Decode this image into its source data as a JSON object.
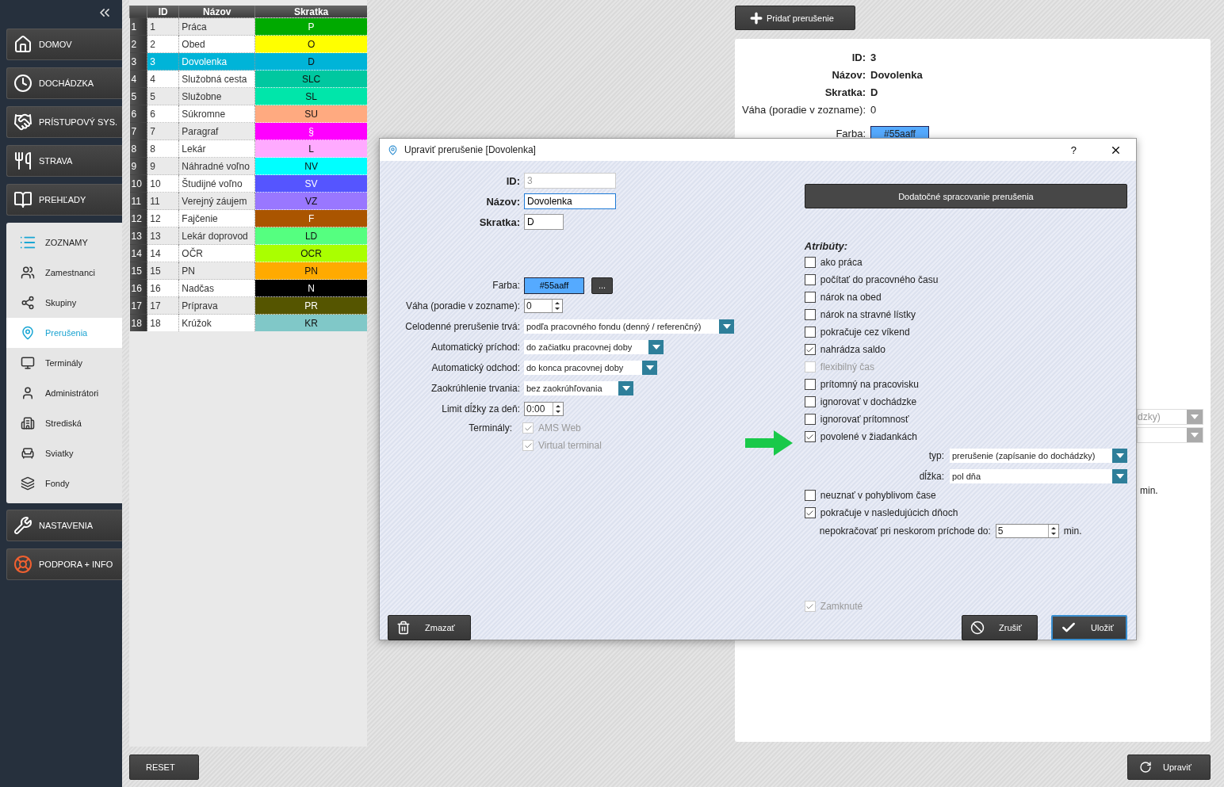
{
  "sidebar": {
    "main_items": [
      {
        "label": "DOMOV",
        "kind": "home"
      },
      {
        "label": "DOCHÁDZKA",
        "kind": "clock"
      },
      {
        "label": "PRÍSTUPOVÝ SYS.",
        "kind": "handshake"
      },
      {
        "label": "STRAVA",
        "kind": "plate"
      },
      {
        "label": "PREHĽADY",
        "kind": "book"
      }
    ],
    "submenu": {
      "title": "ZOZNAMY",
      "items": [
        {
          "label": "Zamestnanci",
          "kind": "users",
          "selected": false
        },
        {
          "label": "Skupiny",
          "kind": "groups",
          "selected": false
        },
        {
          "label": "Prerušenia",
          "kind": "pins",
          "selected": true
        },
        {
          "label": "Terminály",
          "kind": "monitor",
          "selected": false
        },
        {
          "label": "Administrátori",
          "kind": "user",
          "selected": false
        },
        {
          "label": "Strediská",
          "kind": "building",
          "selected": false
        },
        {
          "label": "Sviatky",
          "kind": "lounger",
          "selected": false
        },
        {
          "label": "Fondy",
          "kind": "layers",
          "selected": false
        }
      ]
    },
    "bottom_items": [
      {
        "label": "NASTAVENIA",
        "kind": "tools"
      },
      {
        "label": "PODPORA + INFO",
        "kind": "lifebuoy"
      }
    ]
  },
  "table": {
    "columns": [
      "ID",
      "Názov",
      "Skratka"
    ],
    "rows": [
      {
        "n": "1",
        "id": "1",
        "name": "Práca",
        "code": "P",
        "color": "#00aa00",
        "selected": false
      },
      {
        "n": "2",
        "id": "2",
        "name": "Obed",
        "code": "O",
        "color": "#ffff00",
        "selected": false
      },
      {
        "n": "3",
        "id": "3",
        "name": "Dovolenka",
        "code": "D",
        "color": "#00b4d8",
        "selected": true
      },
      {
        "n": "4",
        "id": "4",
        "name": "Služobná cesta",
        "code": "SLC",
        "color": "#00c8a0",
        "selected": false
      },
      {
        "n": "5",
        "id": "5",
        "name": "Služobne",
        "code": "SL",
        "color": "#00e6aa",
        "selected": false
      },
      {
        "n": "6",
        "id": "6",
        "name": "Súkromne",
        "code": "SU",
        "color": "#ffaa80",
        "selected": false
      },
      {
        "n": "7",
        "id": "7",
        "name": "Paragraf",
        "code": "§",
        "color": "#ff00ff",
        "selected": false
      },
      {
        "n": "8",
        "id": "8",
        "name": "Lekár",
        "code": "L",
        "color": "#ffaaff",
        "selected": false
      },
      {
        "n": "9",
        "id": "9",
        "name": "Náhradné voľno",
        "code": "NV",
        "color": "#00ffff",
        "selected": false
      },
      {
        "n": "10",
        "id": "10",
        "name": "Študijné voľno",
        "code": "SV",
        "color": "#5555ff",
        "selected": false
      },
      {
        "n": "11",
        "id": "11",
        "name": "Verejný záujem",
        "code": "VZ",
        "color": "#9977ff",
        "selected": false
      },
      {
        "n": "12",
        "id": "12",
        "name": "Fajčenie",
        "code": "F",
        "color": "#aa5500",
        "selected": false
      },
      {
        "n": "13",
        "id": "13",
        "name": "Lekár doprovod",
        "code": "LD",
        "color": "#55ff80",
        "selected": false
      },
      {
        "n": "14",
        "id": "14",
        "name": "OČR",
        "code": "OCR",
        "color": "#aaff00",
        "selected": false
      },
      {
        "n": "15",
        "id": "15",
        "name": "PN",
        "code": "PN",
        "color": "#ffaa00",
        "selected": false
      },
      {
        "n": "16",
        "id": "16",
        "name": "Nadčas",
        "code": "N",
        "color": "#000000",
        "selected": false
      },
      {
        "n": "17",
        "id": "17",
        "name": "Príprava",
        "code": "PR",
        "color": "#555500",
        "selected": false
      },
      {
        "n": "18",
        "id": "18",
        "name": "Krúžok",
        "code": "KR",
        "color": "#80c8c8",
        "selected": false
      }
    ]
  },
  "reset_button": "RESET",
  "add_button": "Pridať prerušenie",
  "details": {
    "fields": [
      {
        "label": "ID:",
        "value": "3",
        "bold": true
      },
      {
        "label": "Názov:",
        "value": "Dovolenka",
        "bold": true
      },
      {
        "label": "Skratka:",
        "value": "D",
        "bold": true
      },
      {
        "label": "Váha (poradie v zozname):",
        "value": "0",
        "bold": false
      }
    ],
    "color": {
      "label": "Farba:",
      "value": "#55aaff"
    },
    "partial_select": "dzky)",
    "partial_unit": "min."
  },
  "edit_button": "Upraviť",
  "dialog": {
    "title": "Upraviť prerušenie [Dovolenka]",
    "help": "?",
    "id": {
      "label": "ID:",
      "value": "3"
    },
    "name": {
      "label": "Názov:",
      "value": "Dovolenka"
    },
    "code": {
      "label": "Skratka:",
      "value": "D"
    },
    "color": {
      "label": "Farba:",
      "value": "#55aaff",
      "picker": "..."
    },
    "weight": {
      "label": "Váha (poradie v zozname):",
      "value": "0"
    },
    "selects": [
      {
        "label": "Celodenné prerušenie trvá:",
        "value": "podľa pracovného fondu (denný / referenčný)"
      },
      {
        "label": "Automatický príchod:",
        "value": "do začiatku pracovnej doby"
      },
      {
        "label": "Automatický odchod:",
        "value": "do konca pracovnej doby"
      },
      {
        "label": "Zaokrúhlenie trvania:",
        "value": "bez zaokrúhľovania"
      }
    ],
    "limit": {
      "label": "Limit dĺžky za deň:",
      "value": "0:00"
    },
    "terminals": {
      "label": "Terminály:",
      "items": [
        {
          "label": "AMS Web",
          "checked": true,
          "disabled": true
        },
        {
          "label": "Virtual terminal",
          "checked": true,
          "disabled": true
        }
      ]
    },
    "extra_button": "Dodatočné spracovanie prerušenia",
    "attributes_title": "Atribúty:",
    "attributes": [
      {
        "kind": "plain",
        "label": "ako práca",
        "checked": false,
        "disabled": false
      },
      {
        "kind": "plain",
        "label": "počítať do pracovného času",
        "checked": false,
        "disabled": false
      },
      {
        "kind": "plain",
        "label": "nárok na obed",
        "checked": false,
        "disabled": false
      },
      {
        "kind": "plain",
        "label": "nárok na stravné lístky",
        "checked": false,
        "disabled": false
      },
      {
        "kind": "plain",
        "label": "pokračuje cez víkend",
        "checked": false,
        "disabled": false
      },
      {
        "kind": "plain",
        "label": "nahrádza saldo",
        "checked": true,
        "disabled": false
      },
      {
        "kind": "plain",
        "label": "flexibilný čas",
        "checked": false,
        "disabled": true
      },
      {
        "kind": "plain",
        "label": "prítomný na pracovisku",
        "checked": false,
        "disabled": false
      },
      {
        "kind": "plain",
        "label": "ignorovať v dochádzke",
        "checked": false,
        "disabled": false
      },
      {
        "kind": "plain",
        "label": "ignorovať prítomnosť",
        "checked": false,
        "disabled": false
      },
      {
        "kind": "selects",
        "label": "povolené v žiadankách",
        "checked": true,
        "disabled": false,
        "selects": [
          {
            "label": "typ:",
            "value": "prerušenie (zapísanie do dochádzky)"
          },
          {
            "label": "dĺžka:",
            "value": "pol dňa"
          }
        ]
      },
      {
        "kind": "plain",
        "label": "neuznať v pohyblivom čase",
        "checked": false,
        "disabled": false
      },
      {
        "kind": "spinner",
        "label": "pokračuje v nasledujúcich dňoch",
        "checked": true,
        "disabled": false,
        "spinner": {
          "label": "nepokračovať pri neskorom príchode do:",
          "value": "5",
          "unit": "min."
        }
      }
    ],
    "locked": {
      "label": "Zamknuté",
      "checked": true,
      "disabled": true
    },
    "delete_button": "Zmazať",
    "cancel_button": "Zrušiť",
    "save_button": "Uložiť"
  }
}
